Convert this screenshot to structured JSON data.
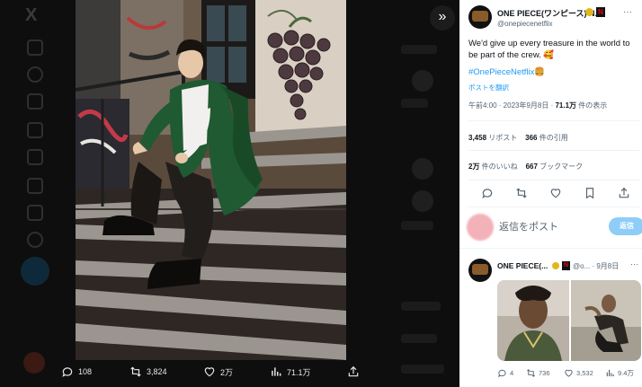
{
  "background": {
    "logo": "X",
    "icons": [
      "home-icon",
      "search-icon",
      "notifications-icon",
      "messages-icon",
      "lists-icon",
      "bookmarks-icon",
      "communities-icon",
      "premium-icon",
      "profile-icon",
      "more-icon"
    ]
  },
  "viewer": {
    "expand_icon": "»",
    "actions": {
      "replies": "108",
      "reposts": "3,824",
      "likes": "2万",
      "views": "71.1万"
    }
  },
  "tweet": {
    "display_name": "ONE PIECE(ワンピース) N...",
    "handle": "@onepiecenetflix",
    "more": "···",
    "text": "We'd give up every treasure in the world to be part of the crew. 🥰",
    "hashtag": "#OnePieceNetflix🍔",
    "translate": "ポストを翻訳",
    "time": "午前4:00 · 2023年9月8日 · ",
    "views_count": "71.1万",
    "views_label": " 件の表示",
    "reposts_count": "3,458",
    "reposts_label": " リポスト",
    "quotes_count": "366",
    "quotes_label": " 件の引用",
    "likes_count": "2万",
    "likes_label": " 件のいいね",
    "bookmarks_count": "667",
    "bookmarks_label": " ブックマーク"
  },
  "composer": {
    "placeholder": "返信をポスト",
    "button": "返信"
  },
  "reply": {
    "display_name": "ONE PIECE(...",
    "handle": "@o... · 9月8日",
    "more": "···",
    "replies": "4",
    "reposts": "736",
    "likes": "3,532",
    "views": "9.4万"
  },
  "colors": {
    "accent": "#1d9bf0",
    "reply_button": "#8ecdf8",
    "gold_badge": "#e2b719",
    "netflix_red": "#e50914"
  }
}
